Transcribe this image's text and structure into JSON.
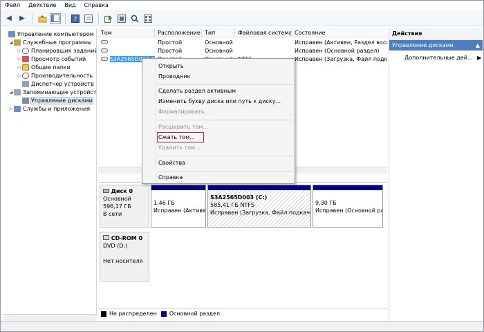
{
  "menubar": {
    "items": [
      "Файл",
      "Действие",
      "Вид",
      "Справка"
    ]
  },
  "toolbar": {
    "icons": [
      "back-icon",
      "forward-icon",
      "up-icon",
      "show-hide-tree-icon",
      "help-icon",
      "properties-icon",
      "export-icon",
      "refresh-icon",
      "search-icon",
      "view-icon"
    ]
  },
  "tree": {
    "items": [
      {
        "label": "Управление компьютером (л",
        "level": 0,
        "expander": "",
        "icon": "computer-management-icon"
      },
      {
        "label": "Служебные программы",
        "level": 1,
        "expander": "◢",
        "icon": "tools-icon"
      },
      {
        "label": "Планировщик заданий",
        "level": 2,
        "expander": "▷",
        "icon": "clock-icon"
      },
      {
        "label": "Просмотр событий",
        "level": 2,
        "expander": "▷",
        "icon": "event-viewer-icon"
      },
      {
        "label": "Общие папки",
        "level": 2,
        "expander": "▷",
        "icon": "shared-folder-icon"
      },
      {
        "label": "Производительность",
        "level": 2,
        "expander": "▷",
        "icon": "performance-icon"
      },
      {
        "label": "Диспетчер устройств",
        "level": 2,
        "expander": "",
        "icon": "device-manager-icon"
      },
      {
        "label": "Запоминающие устройст",
        "level": 1,
        "expander": "◢",
        "icon": "storage-icon"
      },
      {
        "label": "Управление дисками",
        "level": 2,
        "expander": "",
        "icon": "disk-management-icon",
        "selected": true
      },
      {
        "label": "Службы и приложения",
        "level": 1,
        "expander": "▷",
        "icon": "services-icon"
      }
    ]
  },
  "volumes": {
    "headers": [
      "Том",
      "Расположение",
      "Тип",
      "Файловая система",
      "Состояние"
    ],
    "rows": [
      {
        "name": "",
        "layout": "Простой",
        "type": "Основной",
        "fs": "",
        "status": "Исправен (Активен, Раздел восста"
      },
      {
        "name": "",
        "layout": "Простой",
        "type": "Основной",
        "fs": "",
        "status": "Исправен (Основной раздел)"
      },
      {
        "name": "S3A2565D003 (C:)",
        "layout": "Простой",
        "type": "Основной",
        "fs": "NTFS",
        "status": "Исправен (Загрузка, Файл подкачи",
        "selected": true
      }
    ]
  },
  "disks": [
    {
      "title": "Диск 0",
      "kind": "Основной",
      "size": "596,17 ГБ",
      "state": "В сети",
      "partitions": [
        {
          "title": "",
          "size": "1,46 ГБ",
          "status": "Исправен (Активен"
        },
        {
          "title": "S3A2565D003  (C:)",
          "size": "585,41 ГБ NTFS",
          "status": "Исправен (Загрузка, Файл подкачи"
        },
        {
          "title": "",
          "size": "9,30 ГБ",
          "status": "Исправен (Основной раз"
        }
      ]
    },
    {
      "title": "CD-ROM 0",
      "kind": "DVD (D:)",
      "size": "",
      "state": "Нет носителя",
      "partitions": []
    }
  ],
  "legend": {
    "unallocated": "Не распределен",
    "primary": "Основной раздел",
    "unallocated_color": "#000000",
    "primary_color": "#00007f"
  },
  "actions": {
    "title": "Действия",
    "section": "Управление дисками",
    "item": "Дополнительные дей..."
  },
  "context_menu": {
    "items": [
      {
        "label": "Открыть",
        "disabled": false
      },
      {
        "label": "Проводник",
        "disabled": false
      },
      {
        "label": "Сделать раздел активным",
        "disabled": false
      },
      {
        "label": "Изменить букву диска или путь к диску...",
        "disabled": false
      },
      {
        "label": "Форматировать...",
        "disabled": true
      },
      {
        "label": "Расширить том...",
        "disabled": true
      },
      {
        "label": "Сжать том...",
        "disabled": false,
        "highlighted": true
      },
      {
        "label": "Удалить том...",
        "disabled": true
      },
      {
        "label": "Свойства",
        "disabled": false
      },
      {
        "label": "Справка",
        "disabled": false
      }
    ]
  },
  "colors": {
    "accent": "#4d7fbf",
    "selection": "#3399ff",
    "highlight_border": "#c0262b",
    "partition_bar": "#00007f"
  }
}
